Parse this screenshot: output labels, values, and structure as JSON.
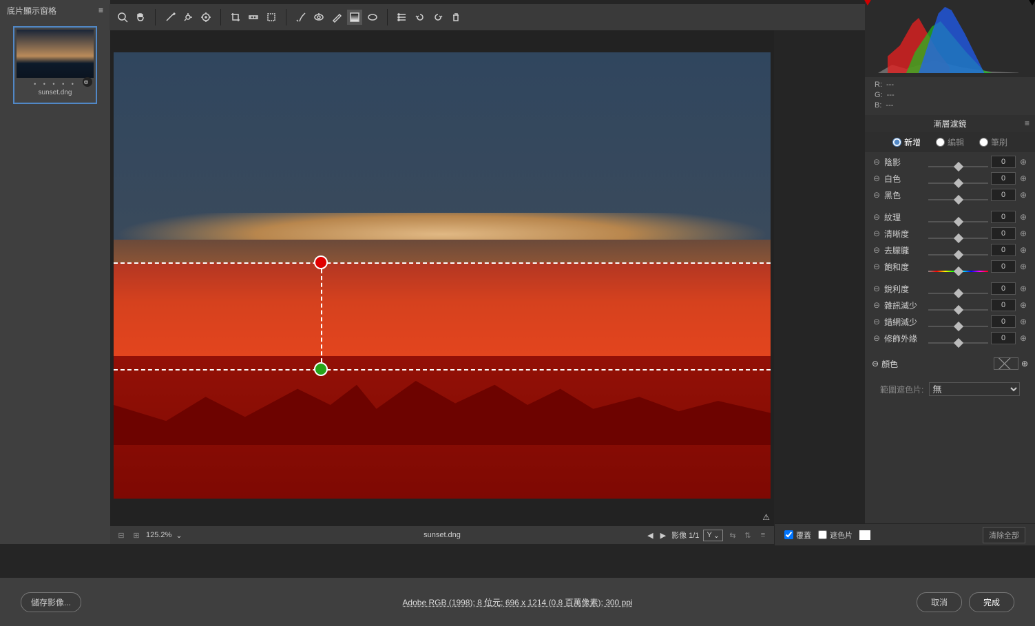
{
  "filmstrip": {
    "header": "底片顯示窗格",
    "thumb_label": "sunset.dng",
    "dots": "• • • • •"
  },
  "toolbar_icons": [
    "zoom",
    "hand",
    "eyedrop",
    "target",
    "sampler",
    "crop",
    "straighten",
    "transform",
    "spot",
    "eye",
    "brush",
    "grad",
    "radial",
    "presets",
    "undo",
    "redo",
    "trash",
    "share"
  ],
  "canvas": {
    "filename": "sunset.dng",
    "image_nav": "影像 1/1",
    "zoom": "125.2%",
    "compare_label": "Y"
  },
  "histogram_readout": {
    "R": "R:",
    "G": "G:",
    "B": "B:",
    "none": "---"
  },
  "panel": {
    "title": "漸層濾鏡",
    "mode_new": "新增",
    "mode_edit": "編輯",
    "mode_brush": "筆刷",
    "sliders_a": [
      {
        "label": "陰影",
        "val": "0"
      },
      {
        "label": "白色",
        "val": "0"
      },
      {
        "label": "黑色",
        "val": "0"
      }
    ],
    "sliders_b": [
      {
        "label": "紋理",
        "val": "0"
      },
      {
        "label": "清晰度",
        "val": "0"
      },
      {
        "label": "去朦朧",
        "val": "0"
      },
      {
        "label": "飽和度",
        "val": "0",
        "sat": true
      }
    ],
    "sliders_c": [
      {
        "label": "銳利度",
        "val": "0"
      },
      {
        "label": "雜訊減少",
        "val": "0"
      },
      {
        "label": "錯網減少",
        "val": "0"
      },
      {
        "label": "修飾外緣",
        "val": "0"
      }
    ],
    "color_label": "顏色",
    "range_mask_label": "範圍遮色片:",
    "range_mask_value": "無"
  },
  "panel_bottom": {
    "overlay": "覆蓋",
    "mask": "遮色片",
    "clear": "清除全部"
  },
  "footer": {
    "save": "儲存影像...",
    "meta": "Adobe RGB (1998); 8 位元; 696 x 1214 (0.8 百萬像素); 300 ppi",
    "cancel": "取消",
    "done": "完成"
  }
}
